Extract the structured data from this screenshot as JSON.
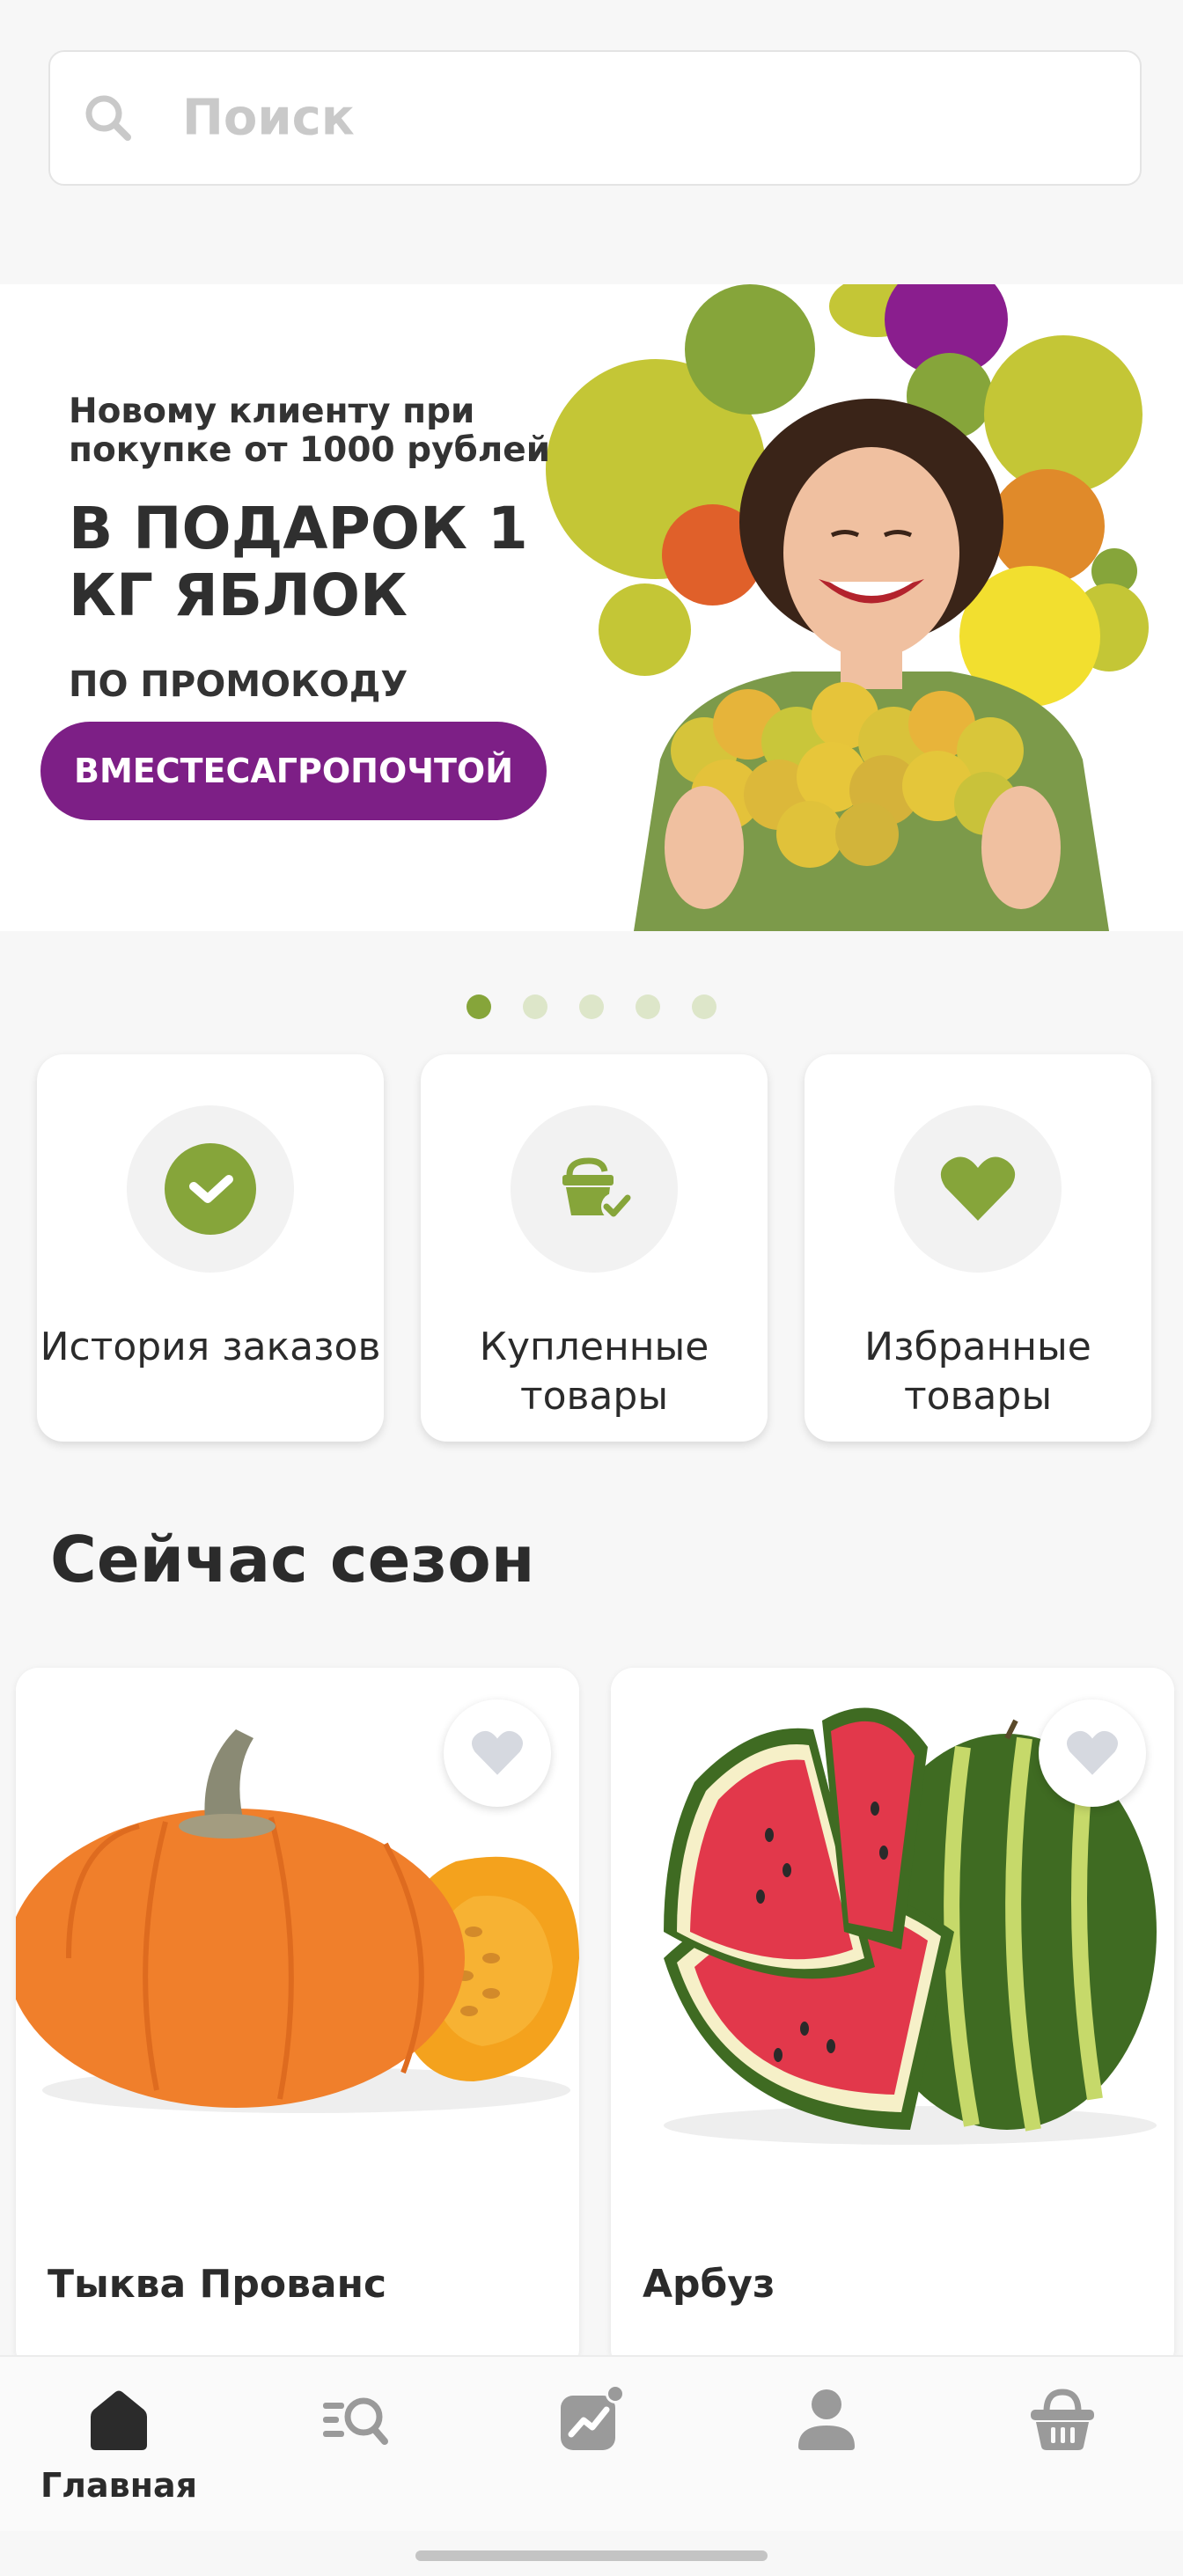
{
  "search": {
    "placeholder": "Поиск",
    "icon": "search-icon"
  },
  "banner": {
    "line1": "Новому клиенту при покупке от 1000 рублей",
    "headline": "В ПОДАРОК 1 КГ ЯБЛОК",
    "code_label": "ПО ПРОМОКОДУ",
    "code": "ВМЕСТЕСАГРОПОЧТОЙ",
    "slide_count": 5,
    "active_slide": 1
  },
  "quick_actions": [
    {
      "label": "История заказов",
      "icon": "check-circle-icon"
    },
    {
      "label": "Купленные товары",
      "icon": "basket-check-icon"
    },
    {
      "label": "Избранные товары",
      "icon": "heart-icon"
    }
  ],
  "season": {
    "title": "Сейчас сезон",
    "products": [
      {
        "name": "Тыква Прованс",
        "image": "pumpkin-image"
      },
      {
        "name": "Арбуз",
        "image": "watermelon-image"
      }
    ]
  },
  "nav": {
    "items": [
      {
        "label": "Главная",
        "icon": "home-icon",
        "active": true
      },
      {
        "label": "",
        "icon": "catalog-search-icon"
      },
      {
        "label": "",
        "icon": "chart-icon"
      },
      {
        "label": "",
        "icon": "profile-icon"
      },
      {
        "label": "",
        "icon": "cart-icon"
      }
    ]
  },
  "colors": {
    "accent": "#86a53a",
    "promo": "#7d1f86",
    "text": "#2b2b2b"
  }
}
